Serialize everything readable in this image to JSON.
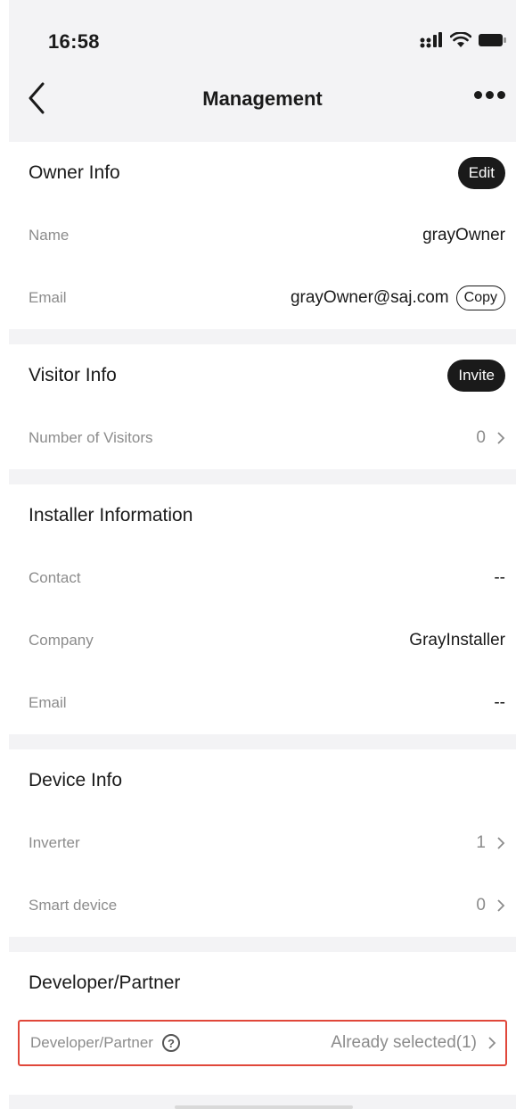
{
  "status_bar": {
    "time": "16:58"
  },
  "nav": {
    "title": "Management"
  },
  "owner": {
    "title": "Owner Info",
    "edit_label": "Edit",
    "name_label": "Name",
    "name_value": "grayOwner",
    "email_label": "Email",
    "email_value": "grayOwner@saj.com",
    "copy_label": "Copy"
  },
  "visitor": {
    "title": "Visitor Info",
    "invite_label": "Invite",
    "count_label": "Number of Visitors",
    "count_value": "0"
  },
  "installer": {
    "title": "Installer Information",
    "contact_label": "Contact",
    "contact_value": "--",
    "company_label": "Company",
    "company_value": "GrayInstaller",
    "email_label": "Email",
    "email_value": "--"
  },
  "device": {
    "title": "Device Info",
    "inverter_label": "Inverter",
    "inverter_value": "1",
    "smart_label": "Smart device",
    "smart_value": "0"
  },
  "developer": {
    "title": "Developer/Partner",
    "row_label": "Developer/Partner",
    "row_value": "Already selected(1)"
  },
  "icons": {
    "back": "chevron-left-icon",
    "more": "more-dots-icon",
    "chevron": "chevron-right-icon",
    "help": "question-circle-icon",
    "signal": "signal-icon",
    "wifi": "wifi-icon",
    "battery": "battery-icon"
  },
  "colors": {
    "background": "#f3f3f5",
    "card": "#ffffff",
    "pill": "#1a1a1a",
    "highlight_border": "#e0473a",
    "muted_text": "#8c8c8c"
  }
}
